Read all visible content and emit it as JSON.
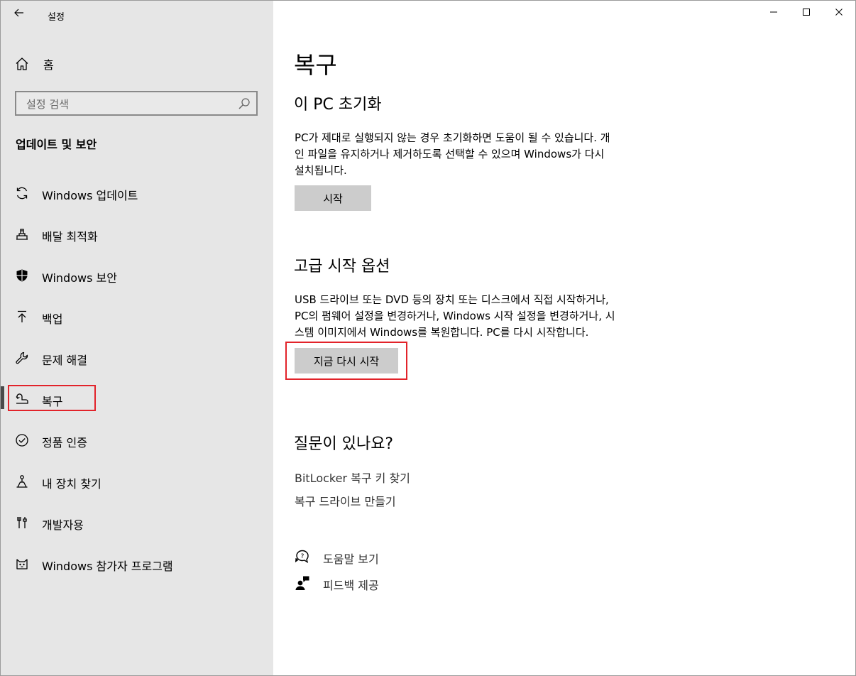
{
  "window": {
    "title": "설정"
  },
  "sidebar": {
    "home_label": "홈",
    "search_placeholder": "설정 검색",
    "section_title": "업데이트 및 보안",
    "items": [
      {
        "label": "Windows 업데이트",
        "icon": "sync-icon"
      },
      {
        "label": "배달 최적화",
        "icon": "delivery-optimization-icon"
      },
      {
        "label": "Windows 보안",
        "icon": "shield-icon"
      },
      {
        "label": "백업",
        "icon": "backup-upload-icon"
      },
      {
        "label": "문제 해결",
        "icon": "wrench-icon"
      },
      {
        "label": "복구",
        "icon": "recovery-icon",
        "selected": true
      },
      {
        "label": "정품 인증",
        "icon": "check-circle-icon"
      },
      {
        "label": "내 장치 찾기",
        "icon": "find-device-person-icon"
      },
      {
        "label": "개발자용",
        "icon": "developer-tools-icon"
      },
      {
        "label": "Windows 참가자 프로그램",
        "icon": "insider-cat-icon"
      }
    ]
  },
  "main": {
    "title": "복구",
    "reset": {
      "heading": "이 PC 초기화",
      "line1": "PC가 제대로 실행되지 않는 경우 초기화하면 도움이 될 수 있습니다. 개",
      "line2": "인 파일을 유지하거나 제거하도록 선택할 수 있으며 Windows가 다시",
      "line3": "설치됩니다.",
      "button": "시작"
    },
    "advanced": {
      "heading": "고급 시작 옵션",
      "line1": "USB 드라이브 또는 DVD 등의 장치 또는 디스크에서 직접 시작하거나,",
      "line2": "PC의 펌웨어 설정을 변경하거나, Windows 시작 설정을 변경하거나, 시",
      "line3": "스템 이미지에서 Windows를 복원합니다. PC를 다시 시작합니다.",
      "button": "지금 다시 시작"
    },
    "questions": {
      "heading": "질문이 있나요?",
      "links": [
        "BitLocker 복구 키 찾기",
        "복구 드라이브 만들기"
      ]
    },
    "help": [
      {
        "label": "도움말 보기",
        "icon": "help-chat-icon"
      },
      {
        "label": "피드백 제공",
        "icon": "feedback-icon"
      }
    ]
  },
  "colors": {
    "highlight": "#e2232a",
    "sidebar_bg": "#e6e6e6",
    "button_bg": "#cccccc",
    "selection_bar": "#4a4a4a"
  }
}
